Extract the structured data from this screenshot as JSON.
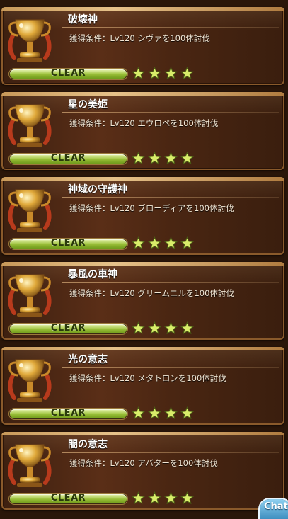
{
  "colors": {
    "card_bg": "#4a2612",
    "gold": "#e6c28a",
    "bar_green": "#9fc43a",
    "star": "#d9ec6a",
    "chat": "#3f8fc0"
  },
  "achievements": [
    {
      "title": "破壊神",
      "condition": "獲得条件：Lv120 シヴァを100体討伐",
      "status": "CLEAR",
      "progress": 1.0,
      "stars": 4
    },
    {
      "title": "星の美姫",
      "condition": "獲得条件：Lv120 エウロペを100体討伐",
      "status": "CLEAR",
      "progress": 1.0,
      "stars": 4
    },
    {
      "title": "神域の守護神",
      "condition": "獲得条件：Lv120 ブローディアを100体討伐",
      "status": "CLEAR",
      "progress": 1.0,
      "stars": 4
    },
    {
      "title": "暴風の車神",
      "condition": "獲得条件：Lv120 グリームニルを100体討伐",
      "status": "CLEAR",
      "progress": 1.0,
      "stars": 4
    },
    {
      "title": "光の意志",
      "condition": "獲得条件：Lv120 メタトロンを100体討伐",
      "status": "CLEAR",
      "progress": 1.0,
      "stars": 4
    },
    {
      "title": "闇の意志",
      "condition": "獲得条件：Lv120 アバターを100体討伐",
      "status": "CLEAR",
      "progress": 1.0,
      "stars": 4
    }
  ],
  "chat_button": {
    "label": "Chat",
    "icon": "chat-bubble-icon"
  }
}
